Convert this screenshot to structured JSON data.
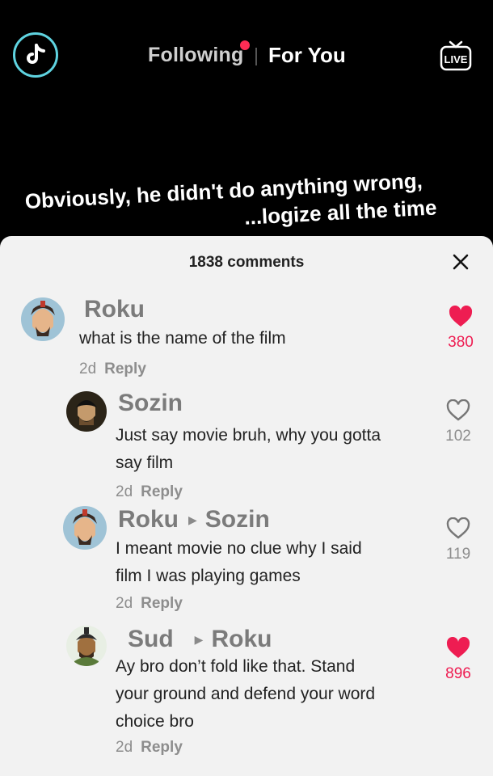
{
  "nav": {
    "following_label": "Following",
    "for_you_label": "For You",
    "live_label": "LIVE"
  },
  "caption": {
    "line1": "Obviously, he didn't do anything wrong,",
    "line2": "...logize all the time"
  },
  "panel": {
    "comment_count": "1838 comments"
  },
  "comments": [
    {
      "user": "Roku",
      "reply_to": "",
      "text": "what is the name of the film",
      "age": "2d",
      "reply": "Reply",
      "likes": "380",
      "liked": true
    },
    {
      "user": "Sozin",
      "reply_to": "",
      "text1": "Just say movie bruh, why you gotta",
      "text2": "say film",
      "age": "2d",
      "reply": "Reply",
      "likes": "102",
      "liked": false
    },
    {
      "user": "Roku",
      "reply_to": "Sozin",
      "text1": "I meant movie no clue why I said",
      "text2": "film I was playing games",
      "age": "2d",
      "reply": "Reply",
      "likes": "119",
      "liked": false
    },
    {
      "user": "Sud",
      "reply_to": "Roku",
      "text1": "Ay bro don’t fold like that. Stand",
      "text2": "your ground and defend your word",
      "text3": "choice bro",
      "age": "2d",
      "reply": "Reply",
      "likes": "896",
      "liked": true
    }
  ],
  "colors": {
    "accent_red": "#fe2c55",
    "like_red": "#ee1d52",
    "logo_ring": "#5fd3e0"
  }
}
